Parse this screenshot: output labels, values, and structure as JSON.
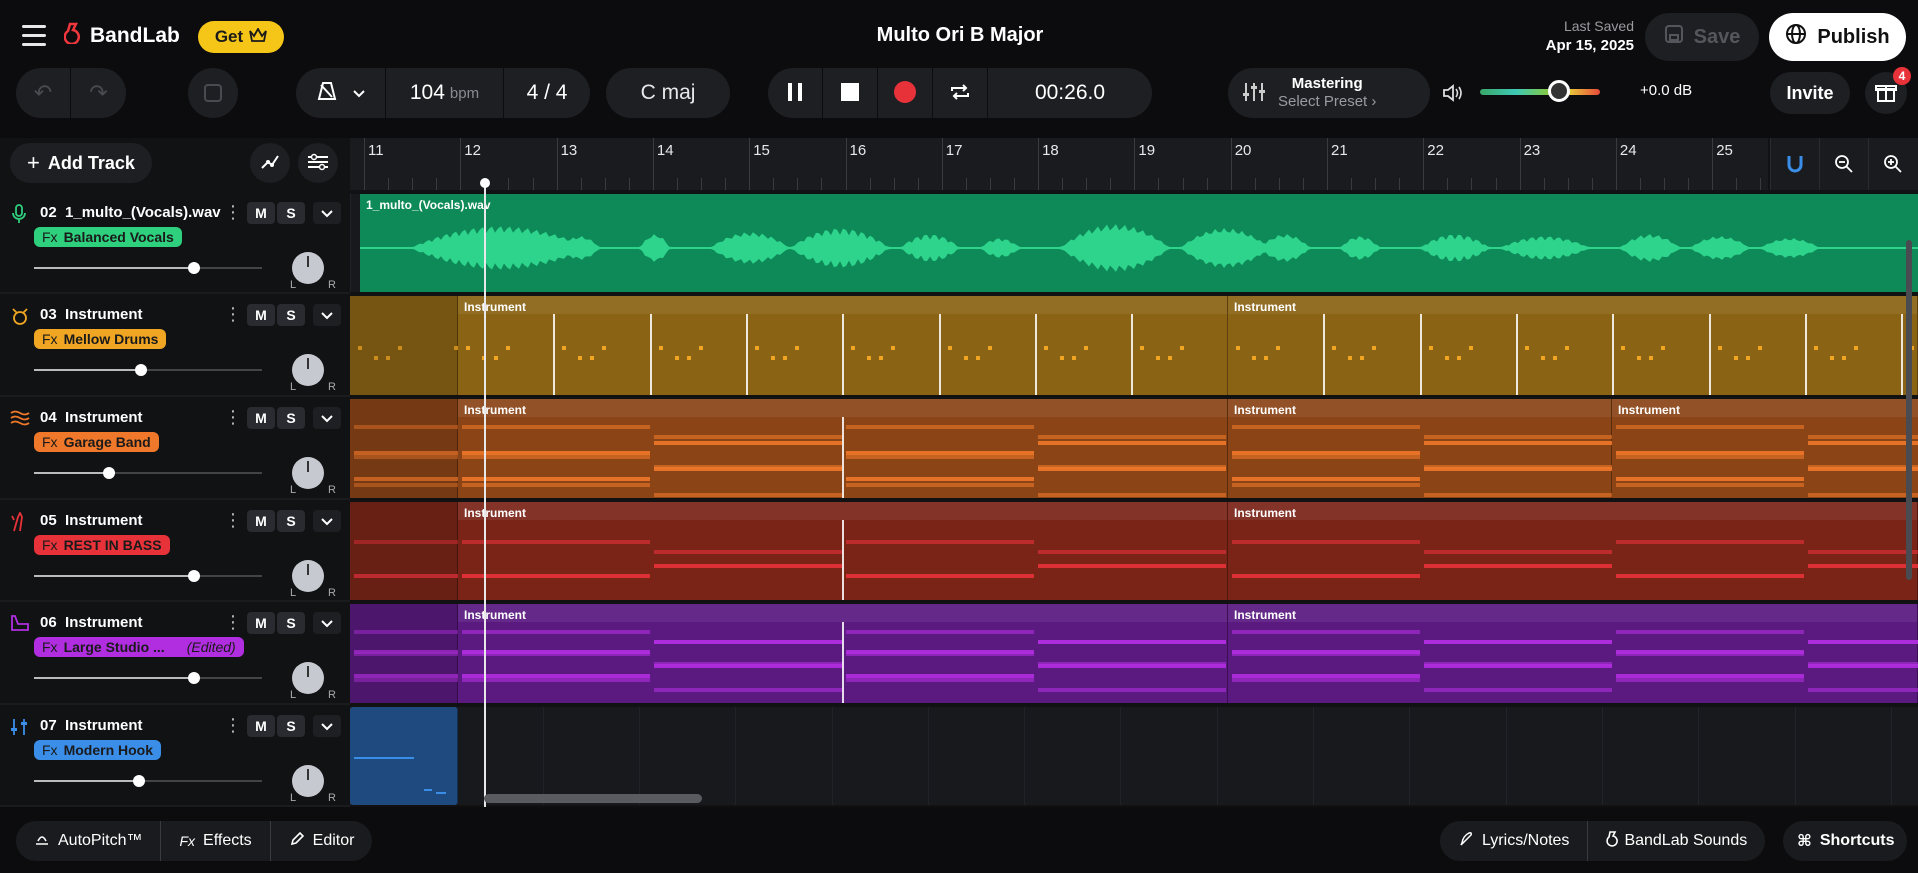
{
  "app": {
    "brand": "BandLab",
    "get_label": "Get",
    "project_title": "Multo Ori B Major"
  },
  "save": {
    "last_saved_label": "Last Saved",
    "last_saved_date": "Apr 15, 2025",
    "save_label": "Save",
    "publish_label": "Publish"
  },
  "transport": {
    "tempo": "104",
    "tempo_unit": "bpm",
    "time_sig": "4 / 4",
    "key": "C maj",
    "time": "00:26.0"
  },
  "mastering": {
    "title": "Mastering",
    "preset": "Select Preset"
  },
  "volume": {
    "level": 0.66,
    "db": "+0.0 dB"
  },
  "invite_label": "Invite",
  "gift_badge": "4",
  "add_track_label": "Add Track",
  "ruler": {
    "bars": [
      "11",
      "12",
      "13",
      "14",
      "15",
      "16",
      "17",
      "18",
      "19",
      "20",
      "21",
      "22",
      "23",
      "24",
      "25"
    ]
  },
  "tracks": [
    {
      "num": "02",
      "name": "1_multo_(Vocals).wav",
      "fx": "Balanced Vocals",
      "fx_color": "#2ecf7d",
      "lane_color": "#0d8a57",
      "volume": 0.7,
      "clip_label": "1_multo_(Vocals).wav",
      "edited": ""
    },
    {
      "num": "03",
      "name": "Instrument",
      "fx": "Mellow Drums",
      "fx_color": "#f0a623",
      "lane_color": "#8a6414",
      "volume": 0.47,
      "clip_label": "Instrument",
      "edited": ""
    },
    {
      "num": "04",
      "name": "Instrument",
      "fx": "Garage Band",
      "fx_color": "#f0782a",
      "lane_color": "#8a4416",
      "volume": 0.33,
      "clip_label": "Instrument",
      "edited": ""
    },
    {
      "num": "05",
      "name": "Instrument",
      "fx": "REST IN BASS",
      "fx_color": "#e8323a",
      "lane_color": "#7a2418",
      "volume": 0.7,
      "clip_label": "Instrument",
      "edited": ""
    },
    {
      "num": "06",
      "name": "Instrument",
      "fx": "Large Studio ...",
      "fx_color": "#b02ee0",
      "lane_color": "#5a1a80",
      "volume": 0.7,
      "clip_label": "Instrument",
      "edited": "(Edited)"
    },
    {
      "num": "07",
      "name": "Instrument",
      "fx": "Modern Hook",
      "fx_color": "#3a8ee8",
      "lane_color": "#1e4a80",
      "volume": 0.46,
      "clip_label": "",
      "edited": ""
    }
  ],
  "pan_l": "L",
  "pan_r": "R",
  "track_buttons": {
    "mute": "M",
    "solo": "S"
  },
  "footer": {
    "autopitch": "AutoPitch™",
    "effects": "Effects",
    "editor": "Editor",
    "lyrics": "Lyrics/Notes",
    "sounds": "BandLab Sounds",
    "shortcuts": "Shortcuts"
  },
  "colors": {
    "accent": "#f0373d",
    "publish_bg": "#ffffff",
    "get_bg": "#f5c518",
    "record": "#e8323a"
  }
}
